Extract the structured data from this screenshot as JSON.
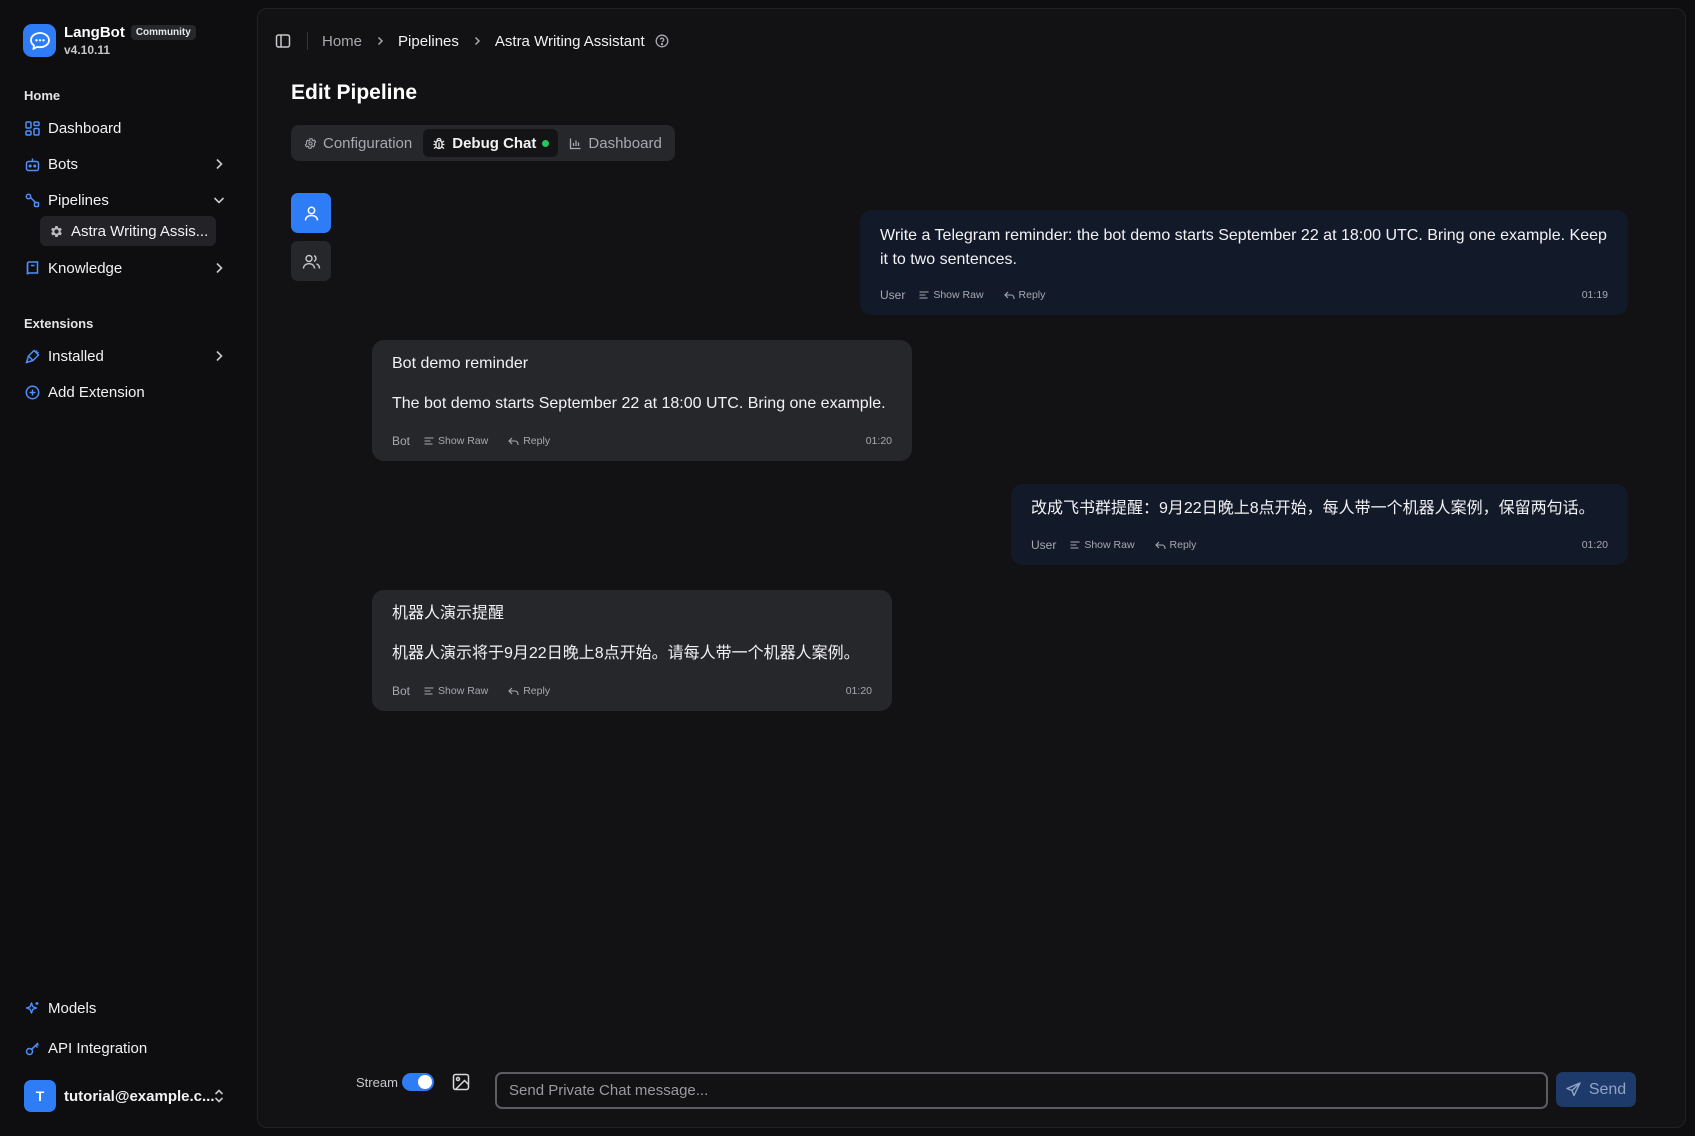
{
  "brand": {
    "name": "LangBot",
    "badge": "Community",
    "version": "v4.10.11"
  },
  "sidebar": {
    "home_label": "Home",
    "extensions_label": "Extensions",
    "items": {
      "dashboard": "Dashboard",
      "bots": "Bots",
      "pipelines": "Pipelines",
      "pipeline_child": "Astra Writing Assis...",
      "knowledge": "Knowledge",
      "installed": "Installed",
      "add_extension": "Add Extension",
      "models": "Models",
      "api_integration": "API Integration"
    },
    "user": {
      "avatar_letter": "T",
      "email": "tutorial@example.c..."
    }
  },
  "breadcrumb": {
    "home": "Home",
    "pipelines": "Pipelines",
    "current": "Astra Writing Assistant"
  },
  "page_title": "Edit Pipeline",
  "tabs": {
    "configuration": "Configuration",
    "debug_chat": "Debug Chat",
    "dashboard": "Dashboard",
    "active": "Debug Chat"
  },
  "messages": [
    {
      "role": "User",
      "lines": [
        "Write a Telegram reminder: the bot demo starts September 22 at 18:00 UTC. Bring one example. Keep it to two sentences."
      ],
      "time": "01:19"
    },
    {
      "role": "Bot",
      "lines": [
        "Bot demo reminder",
        "The bot demo starts September 22 at 18:00 UTC. Bring one example."
      ],
      "time": "01:20"
    },
    {
      "role": "User",
      "lines": [
        "改成飞书群提醒：9月22日晚上8点开始，每人带一个机器人案例，保留两句话。"
      ],
      "time": "01:20"
    },
    {
      "role": "Bot",
      "lines": [
        "机器人演示提醒",
        "机器人演示将于9月22日晚上8点开始。请每人带一个机器人案例。"
      ],
      "time": "01:20"
    }
  ],
  "message_actions": {
    "show_raw": "Show Raw",
    "reply": "Reply"
  },
  "composer": {
    "stream_label": "Stream",
    "stream_enabled": true,
    "placeholder": "Send Private Chat message...",
    "value": "",
    "send_label": "Send"
  },
  "colors": {
    "accent": "#2e7cf6",
    "status_online": "#22c55e",
    "user_bubble": "#121a2a",
    "bot_bubble": "#26272b"
  },
  "icons": {
    "logo": "chat-bubble-icon",
    "sidebar_toggle": "panel-left-icon",
    "help": "help-circle-icon",
    "configuration": "gear-icon",
    "debug": "bug-icon",
    "dashboard": "bar-chart-icon",
    "private_chat": "user-icon",
    "group_chat": "users-icon",
    "image": "image-icon",
    "send": "send-icon"
  }
}
